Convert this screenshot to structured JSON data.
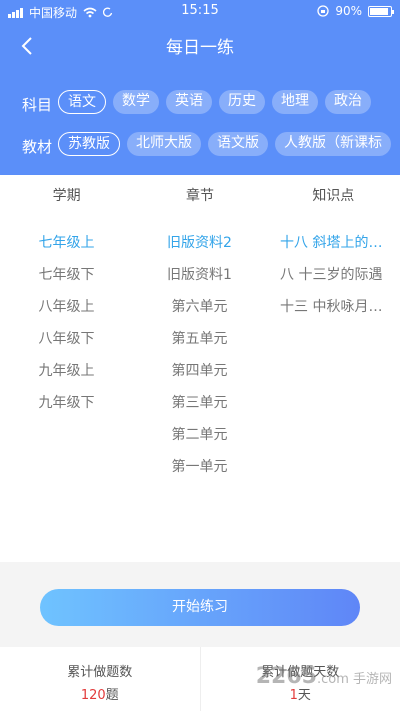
{
  "status_bar": {
    "carrier": "中国移动",
    "time": "15:15",
    "battery": "90%"
  },
  "header": {
    "title": "每日一练"
  },
  "subject_row": {
    "label": "科目",
    "items": [
      "语文",
      "数学",
      "英语",
      "历史",
      "地理",
      "政治"
    ]
  },
  "textbook_row": {
    "label": "教材",
    "items": [
      "苏教版",
      "北师大版",
      "语文版",
      "人教版（新课标"
    ]
  },
  "tabs": [
    "学期",
    "章节",
    "知识点"
  ],
  "semesters": [
    "七年级上",
    "七年级下",
    "八年级上",
    "八年级下",
    "九年级上",
    "九年级下"
  ],
  "chapters": [
    "旧版资料2",
    "旧版资料1",
    "第六单元",
    "第五单元",
    "第四单元",
    "第三单元",
    "第二单元",
    "第一单元"
  ],
  "knowledge_points": [
    "十八 斜塔上的实验",
    "八 十三岁的际遇",
    "十三 中秋咏月诗词"
  ],
  "start_button": "开始练习",
  "stats": [
    {
      "label": "累计做题数",
      "value": "120",
      "unit": "题"
    },
    {
      "label": "累计做题天数",
      "value": "1",
      "unit": "天"
    }
  ],
  "watermark": {
    "main": "2265",
    "suffix": ".com 手游网"
  },
  "colors": {
    "header": "#5b8ff9",
    "selected": "#33a4e9",
    "stat_value": "#e23b3b"
  }
}
